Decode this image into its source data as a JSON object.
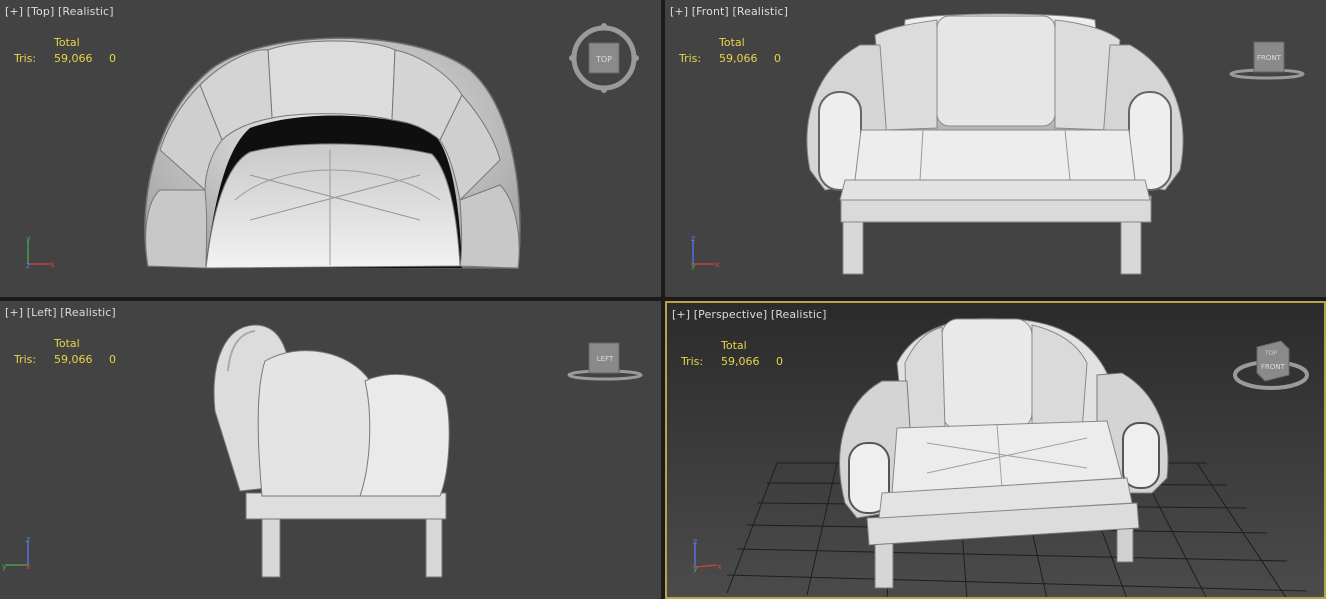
{
  "viewports": [
    {
      "plus": "[+]",
      "view": "[Top]",
      "shading": "[Realistic]",
      "stats": {
        "total_label": "Total",
        "tris_label": "Tris:",
        "tris_value": "59,066",
        "selected_value": "0"
      },
      "viewcube": "TOP",
      "axes": [
        "y",
        "z",
        "x"
      ]
    },
    {
      "plus": "[+]",
      "view": "[Front]",
      "shading": "[Realistic]",
      "stats": {
        "total_label": "Total",
        "tris_label": "Tris:",
        "tris_value": "59,066",
        "selected_value": "0"
      },
      "viewcube": "FRONT",
      "axes": [
        "z",
        "y",
        "x"
      ]
    },
    {
      "plus": "[+]",
      "view": "[Left]",
      "shading": "[Realistic]",
      "stats": {
        "total_label": "Total",
        "tris_label": "Tris:",
        "tris_value": "59,066",
        "selected_value": "0"
      },
      "viewcube": "LEFT",
      "axes": [
        "z",
        "x",
        "y"
      ]
    },
    {
      "plus": "[+]",
      "view": "[Perspective]",
      "shading": "[Realistic]",
      "stats": {
        "total_label": "Total",
        "tris_label": "Tris:",
        "tris_value": "59,066",
        "selected_value": "0"
      },
      "viewcube": "FRONT",
      "viewcube_top": "TOP",
      "axes": [
        "z",
        "y",
        "x"
      ]
    }
  ],
  "colors": {
    "stats_text": "#e6d64a",
    "active_border": "#b9a34a",
    "viewport_bg": "#434343"
  }
}
